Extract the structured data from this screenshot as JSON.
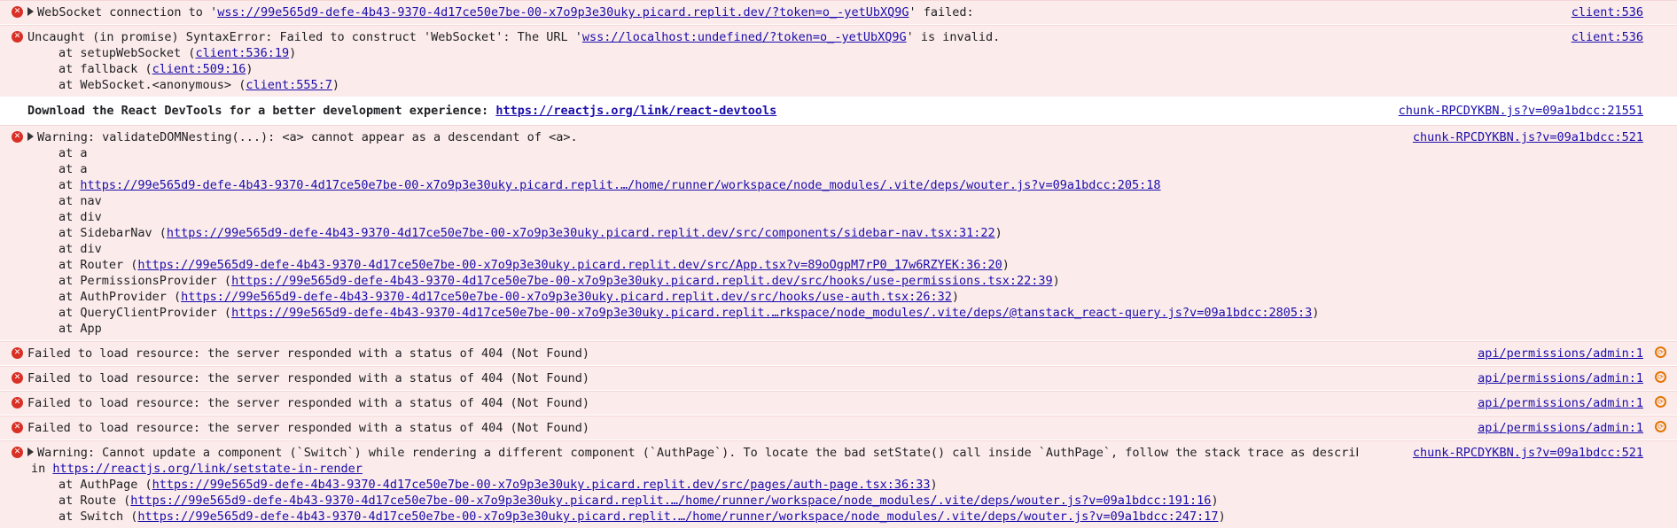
{
  "messages": {
    "ws_failed": {
      "prefix": "WebSocket connection to '",
      "url": "wss://99e565d9-defe-4b43-9370-4d17ce50e7be-00-x7o9p3e30uky.picard.replit.dev/?token=o_-yetUbXQ9G",
      "suffix": "' failed:",
      "source": "client:536"
    },
    "syntax_error": {
      "prefix": "Uncaught (in promise) SyntaxError: Failed to construct 'WebSocket': The URL '",
      "url": "wss://localhost:undefined/?token=o_-yetUbXQ9G",
      "suffix": "' is invalid.",
      "source": "client:536",
      "stack": [
        {
          "pre": "at setupWebSocket (",
          "link": "client:536:19",
          "post": ")"
        },
        {
          "pre": "at fallback (",
          "link": "client:509:16",
          "post": ")"
        },
        {
          "pre": "at WebSocket.<anonymous> (",
          "link": "client:555:7",
          "post": ")"
        }
      ]
    },
    "devtools": {
      "text": "Download the React DevTools for a better development experience: ",
      "url": "https://reactjs.org/link/react-devtools",
      "source": "chunk-RPCDYKBN.js?v=09a1bdcc:21551"
    },
    "dom_nesting": {
      "text": "Warning: validateDOMNesting(...): <a> cannot appear as a descendant of <a>.",
      "source": "chunk-RPCDYKBN.js?v=09a1bdcc:521",
      "stack": [
        {
          "pre": "at a",
          "link": "",
          "post": ""
        },
        {
          "pre": "at a",
          "link": "",
          "post": ""
        },
        {
          "pre": "at ",
          "link": "https://99e565d9-defe-4b43-9370-4d17ce50e7be-00-x7o9p3e30uky.picard.replit.…/home/runner/workspace/node_modules/.vite/deps/wouter.js?v=09a1bdcc:205:18",
          "post": ""
        },
        {
          "pre": "at nav",
          "link": "",
          "post": ""
        },
        {
          "pre": "at div",
          "link": "",
          "post": ""
        },
        {
          "pre": "at SidebarNav (",
          "link": "https://99e565d9-defe-4b43-9370-4d17ce50e7be-00-x7o9p3e30uky.picard.replit.dev/src/components/sidebar-nav.tsx:31:22",
          "post": ")"
        },
        {
          "pre": "at div",
          "link": "",
          "post": ""
        },
        {
          "pre": "at Router (",
          "link": "https://99e565d9-defe-4b43-9370-4d17ce50e7be-00-x7o9p3e30uky.picard.replit.dev/src/App.tsx?v=89oOgpM7rP0_17w6RZYEK:36:20",
          "post": ")"
        },
        {
          "pre": "at PermissionsProvider (",
          "link": "https://99e565d9-defe-4b43-9370-4d17ce50e7be-00-x7o9p3e30uky.picard.replit.dev/src/hooks/use-permissions.tsx:22:39",
          "post": ")"
        },
        {
          "pre": "at AuthProvider (",
          "link": "https://99e565d9-defe-4b43-9370-4d17ce50e7be-00-x7o9p3e30uky.picard.replit.dev/src/hooks/use-auth.tsx:26:32",
          "post": ")"
        },
        {
          "pre": "at QueryClientProvider (",
          "link": "https://99e565d9-defe-4b43-9370-4d17ce50e7be-00-x7o9p3e30uky.picard.replit.…rkspace/node_modules/.vite/deps/@tanstack_react-query.js?v=09a1bdcc:2805:3",
          "post": ")"
        },
        {
          "pre": "at App",
          "link": "",
          "post": ""
        }
      ]
    },
    "resource_404": [
      {
        "text": "Failed to load resource: the server responded with a status of 404 (Not Found)",
        "source": "api/permissions/admin:1"
      },
      {
        "text": "Failed to load resource: the server responded with a status of 404 (Not Found)",
        "source": "api/permissions/admin:1"
      },
      {
        "text": "Failed to load resource: the server responded with a status of 404 (Not Found)",
        "source": "api/permissions/admin:1"
      },
      {
        "text": "Failed to load resource: the server responded with a status of 404 (Not Found)",
        "source": "api/permissions/admin:1"
      }
    ],
    "switch_warning": {
      "text": "Warning: Cannot update a component (`Switch`) while rendering a different component (`AuthPage`). To locate the bad setState() call inside `AuthPage`, follow the stack trace as described",
      "in_prefix": "in ",
      "url": "https://reactjs.org/link/setstate-in-render",
      "source": "chunk-RPCDYKBN.js?v=09a1bdcc:521",
      "stack": [
        {
          "pre": "at AuthPage (",
          "link": "https://99e565d9-defe-4b43-9370-4d17ce50e7be-00-x7o9p3e30uky.picard.replit.dev/src/pages/auth-page.tsx:36:33",
          "post": ")"
        },
        {
          "pre": "at Route (",
          "link": "https://99e565d9-defe-4b43-9370-4d17ce50e7be-00-x7o9p3e30uky.picard.replit.…/home/runner/workspace/node_modules/.vite/deps/wouter.js?v=09a1bdcc:191:16",
          "post": ")"
        },
        {
          "pre": "at Switch (",
          "link": "https://99e565d9-defe-4b43-9370-4d17ce50e7be-00-x7o9p3e30uky.picard.replit.…/home/runner/workspace/node_modules/.vite/deps/wouter.js?v=09a1bdcc:247:17",
          "post": ")"
        }
      ]
    }
  },
  "icons": {
    "error": "error-circle-icon",
    "expand": "expand-triangle-icon",
    "replay": "network-request-icon"
  },
  "colors": {
    "error_bg": "#fcebeb",
    "error_icon": "#d93025",
    "link": "#1a0dab",
    "network_icon": "#e37400"
  }
}
